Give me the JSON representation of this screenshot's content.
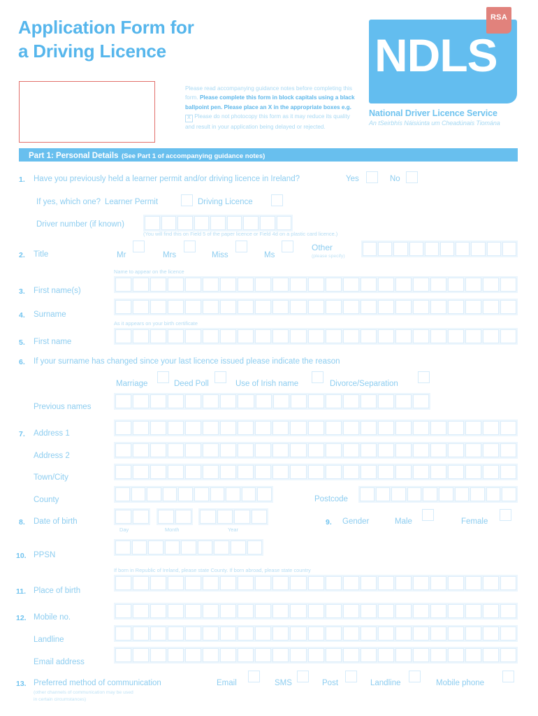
{
  "header": {
    "title_line1": "Application Form for",
    "title_line2": "a Driving Licence",
    "instructions_part1": "Please read accompanying guidance notes before completing this form. ",
    "instructions_bold": "Please complete this form in block capitals using a black ballpoint pen. Please place an X in the appropriate boxes e.g.",
    "example_mark": "X",
    "instructions_part2": " Please do not photocopy this form as it may reduce its quality and result in your application being delayed or rejected.",
    "logo_text": "NDLS",
    "logo_badge": "RSA",
    "logo_subtitle_en": "National Driver Licence Service",
    "logo_subtitle_ga": "An tSeirbhís Náisiúnta um Cheadúnais Tiomána"
  },
  "section": {
    "title": "Part 1: Personal Details",
    "note": "(See Part 1 of accompanying guidance notes)"
  },
  "questions": {
    "q1": {
      "num": "1.",
      "label": "Have you previously held a learner permit and/or driving licence in Ireland?",
      "yes": "Yes",
      "no": "No",
      "sub_label": "If yes, which one?",
      "learner_permit": "Learner Permit",
      "driving_licence": "Driving Licence",
      "driver_number_label": "Driver number (if known)",
      "driver_number_hint": "(You will find this on Field 5 of the paper licence or Field 4d on a plastic card licence.)",
      "driver_number_cells": 9
    },
    "q2": {
      "num": "2.",
      "label": "Title",
      "mr": "Mr",
      "mrs": "Mrs",
      "miss": "Miss",
      "ms": "Ms",
      "other": "Other",
      "other_hint": "(please specify)",
      "other_cells": 10
    },
    "q3": {
      "num": "3.",
      "label": "First name(s)",
      "hint": "Name to appear on the licence",
      "cells": 23
    },
    "q4": {
      "num": "4.",
      "label": "Surname",
      "cells": 23
    },
    "q5": {
      "num": "5.",
      "label": "First name",
      "hint": "As it appears on your birth certificate",
      "cells": 23
    },
    "q6": {
      "num": "6.",
      "label": "If your surname has changed since your last licence issued please indicate the reason",
      "marriage": "Marriage",
      "deed_poll": "Deed Poll",
      "irish_name": "Use of Irish name",
      "divorce": "Divorce/Separation",
      "previous_names_label": "Previous names",
      "previous_names_cells": 18
    },
    "q7": {
      "num": "7.",
      "address1_label": "Address 1",
      "address1_cells": 23,
      "address2_label": "Address 2",
      "address2_cells": 23,
      "town_label": "Town/City",
      "town_cells": 23,
      "county_label": "County",
      "county_cells": 10,
      "postcode_label": "Postcode",
      "postcode_cells": 10
    },
    "q8": {
      "num": "8.",
      "label": "Date of birth",
      "day_label": "Day",
      "month_label": "Month",
      "year_label": "Year",
      "day_cells": 2,
      "month_cells": 2,
      "year_cells": 4
    },
    "q9": {
      "num": "9.",
      "label": "Gender",
      "male": "Male",
      "female": "Female"
    },
    "q10": {
      "num": "10.",
      "label": "PPSN",
      "cells": 9
    },
    "q11": {
      "num": "11.",
      "label": "Place of birth",
      "hint": "If born in Republic of Ireland, please state County. If born abroad, please state country",
      "cells": 23
    },
    "q12": {
      "num": "12.",
      "mobile_label": "Mobile no.",
      "mobile_cells": 23,
      "landline_label": "Landline",
      "landline_cells": 23,
      "email_label": "Email address",
      "email_cells": 23
    },
    "q13": {
      "num": "13.",
      "label": "Preferred method of communication",
      "note_line1": "(other channels of communication may be used",
      "note_line2": "in certain circumstances)",
      "email": "Email",
      "sms": "SMS",
      "post": "Post",
      "landline": "Landline",
      "mobile_phone": "Mobile phone"
    }
  },
  "colors": {
    "brand_blue": "#63bdef",
    "light_blue": "#8fcdf0",
    "pale_blue": "#ecf6fd",
    "rsa_red": "#e1827c"
  }
}
